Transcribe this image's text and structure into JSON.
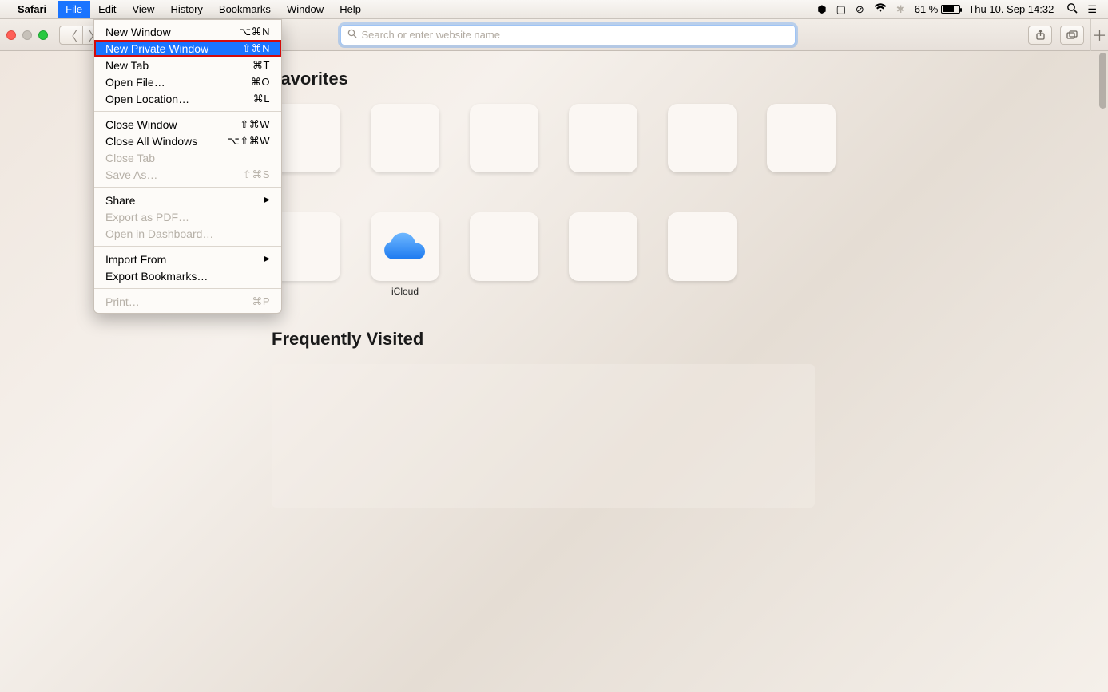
{
  "menubar": {
    "app": "Safari",
    "items": [
      "File",
      "Edit",
      "View",
      "History",
      "Bookmarks",
      "Window",
      "Help"
    ],
    "active_index": 0,
    "battery_pct": "61 %",
    "clock": "Thu 10. Sep  14:32"
  },
  "toolbar": {
    "search_placeholder": "Search or enter website name"
  },
  "file_menu": {
    "groups": [
      [
        {
          "label": "New Window",
          "shortcut": "⌥⌘N",
          "disabled": false,
          "selected": false
        },
        {
          "label": "New Private Window",
          "shortcut": "⇧⌘N",
          "disabled": false,
          "selected": true
        },
        {
          "label": "New Tab",
          "shortcut": "⌘T",
          "disabled": false,
          "selected": false
        },
        {
          "label": "Open File…",
          "shortcut": "⌘O",
          "disabled": false,
          "selected": false
        },
        {
          "label": "Open Location…",
          "shortcut": "⌘L",
          "disabled": false,
          "selected": false
        }
      ],
      [
        {
          "label": "Close Window",
          "shortcut": "⇧⌘W",
          "disabled": false,
          "selected": false
        },
        {
          "label": "Close All Windows",
          "shortcut": "⌥⇧⌘W",
          "disabled": false,
          "selected": false
        },
        {
          "label": "Close Tab",
          "shortcut": "",
          "disabled": true,
          "selected": false
        },
        {
          "label": "Save As…",
          "shortcut": "⇧⌘S",
          "disabled": true,
          "selected": false
        }
      ],
      [
        {
          "label": "Share",
          "shortcut": "",
          "submenu": true,
          "disabled": false,
          "selected": false
        },
        {
          "label": "Export as PDF…",
          "shortcut": "",
          "disabled": true,
          "selected": false
        },
        {
          "label": "Open in Dashboard…",
          "shortcut": "",
          "disabled": true,
          "selected": false
        }
      ],
      [
        {
          "label": "Import From",
          "shortcut": "",
          "submenu": true,
          "disabled": false,
          "selected": false
        },
        {
          "label": "Export Bookmarks…",
          "shortcut": "",
          "disabled": false,
          "selected": false
        }
      ],
      [
        {
          "label": "Print…",
          "shortcut": "⌘P",
          "disabled": true,
          "selected": false
        }
      ]
    ]
  },
  "page": {
    "favorites_title": "Favorites",
    "freq_title": "Frequently Visited",
    "favorites_row1": [
      {
        "label": ""
      },
      {
        "label": ""
      },
      {
        "label": ""
      },
      {
        "label": ""
      },
      {
        "label": ""
      },
      {
        "label": ""
      }
    ],
    "favorites_row2": [
      {
        "label": ""
      },
      {
        "label": "iCloud",
        "icon": "icloud"
      },
      {
        "label": ""
      },
      {
        "label": ""
      },
      {
        "label": ""
      }
    ]
  }
}
